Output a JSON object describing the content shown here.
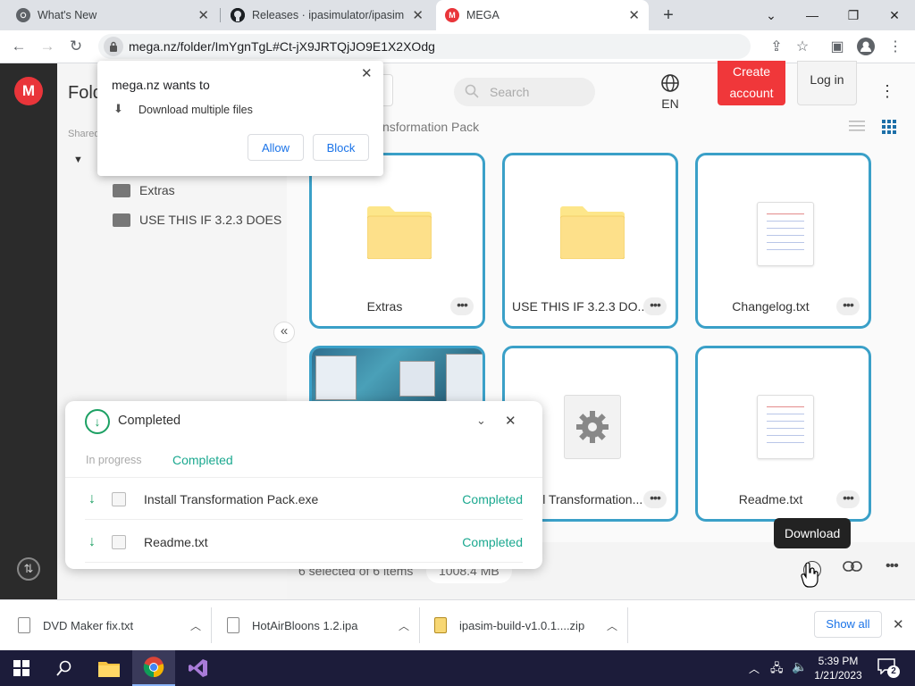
{
  "browser": {
    "tabs": [
      {
        "title": "What's New"
      },
      {
        "title": "Releases · ipasimulator/ipasim · G"
      },
      {
        "title": "MEGA"
      }
    ],
    "new_tab": "+",
    "url": "mega.nz/folder/ImYgnTgL#Ct-jX9JRTQjJO9E1X2XOdg"
  },
  "permission": {
    "site": "mega.nz wants to",
    "request": "Download multiple files",
    "allow": "Allow",
    "block": "Block"
  },
  "mega": {
    "title_partial": "Fold",
    "shared_partial": "Shared",
    "tree": [
      {
        "label": "Extras"
      },
      {
        "label": "USE THIS IF 3.2.3 DOES"
      }
    ],
    "breadcrumb_partial": "nsformation Pack",
    "search_placeholder": "Search",
    "lang": "EN",
    "create_account": "Create account",
    "log_in": "Log in",
    "collapse_glyph": "«",
    "cards": [
      {
        "label": "Extras",
        "kind": "folder"
      },
      {
        "label": "USE THIS IF 3.2.3 DO...",
        "kind": "folder"
      },
      {
        "label": "Changelog.txt",
        "kind": "doc"
      },
      {
        "label": "",
        "kind": "image"
      },
      {
        "label": "Install Transformation...",
        "kind": "exe"
      },
      {
        "label": "Readme.txt",
        "kind": "doc"
      }
    ],
    "selection": "6 selected of 6 items",
    "selection_size": "1008.4 MB",
    "tooltip": "Download"
  },
  "transfers": {
    "header": "Completed",
    "tab_in_progress": "In progress",
    "tab_completed": "Completed",
    "rows": [
      {
        "name": "Install Transformation Pack.exe",
        "status": "Completed"
      },
      {
        "name": "Readme.txt",
        "status": "Completed"
      }
    ]
  },
  "downloads": {
    "items": [
      {
        "name": "DVD Maker fix.txt"
      },
      {
        "name": "HotAirBloons 1.2.ipa"
      },
      {
        "name": "ipasim-build-v1.0.1....zip"
      }
    ],
    "show_all": "Show all"
  },
  "taskbar": {
    "time": "5:39 PM",
    "date": "1/21/2023",
    "notif_count": "2"
  },
  "colors": {
    "mega_red": "#e9353a",
    "card_border": "#3aa0c8",
    "completed_green": "#1aa88f",
    "folder_yellow": "#fde68a"
  }
}
